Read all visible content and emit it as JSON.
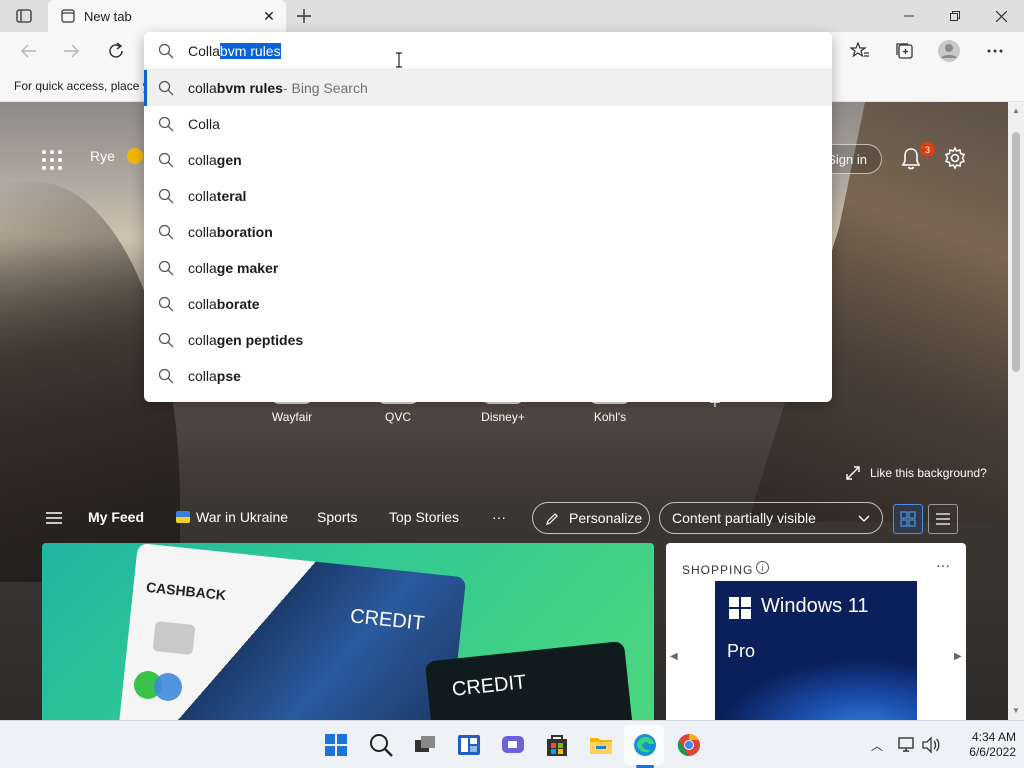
{
  "browser": {
    "tab": {
      "title": "New tab"
    },
    "favorites_bar_text": "For quick access, place y"
  },
  "omnibox": {
    "typed": "Colla",
    "selected": "bvm rules",
    "suggestions": [
      {
        "prefix": "colla",
        "bold": "bvm rules",
        "meta": " - Bing Search"
      },
      {
        "prefix": "Colla",
        "bold": "",
        "meta": ""
      },
      {
        "prefix": "colla",
        "bold": "gen",
        "meta": ""
      },
      {
        "prefix": "colla",
        "bold": "teral",
        "meta": ""
      },
      {
        "prefix": "colla",
        "bold": "boration",
        "meta": ""
      },
      {
        "prefix": "colla",
        "bold": "ge maker",
        "meta": ""
      },
      {
        "prefix": "colla",
        "bold": "borate",
        "meta": ""
      },
      {
        "prefix": "colla",
        "bold": "gen peptides",
        "meta": ""
      },
      {
        "prefix": "colla",
        "bold": "pse",
        "meta": ""
      }
    ]
  },
  "newtab": {
    "weather_location": "Rye",
    "signin_label": "Sign in",
    "notification_count": "3",
    "quick_links": [
      "Wayfair",
      "QVC",
      "Disney+",
      "Kohl's"
    ],
    "add_site": "+",
    "like_background": "Like this background?",
    "feed_nav": {
      "my_feed": "My Feed",
      "war_in_ukraine": "War in Ukraine",
      "sports": "Sports",
      "top_stories": "Top Stories",
      "more": "···",
      "personalize": "Personalize",
      "visibility": "Content partially visible"
    },
    "hero_card": {
      "card_label_1": "CASHBACK",
      "card_label_2": "CREDIT",
      "card_label_3": "CREDIT"
    },
    "shopping_card": {
      "label": "SHOPPING",
      "more": "···",
      "product_name": "Windows 11",
      "product_edition": "Pro"
    }
  },
  "taskbar": {
    "time": "4:34 AM",
    "date": "6/6/2022"
  },
  "colors": {
    "accent": "#0a64d6",
    "badge": "#d4420f",
    "hero_green": "#30c994"
  }
}
